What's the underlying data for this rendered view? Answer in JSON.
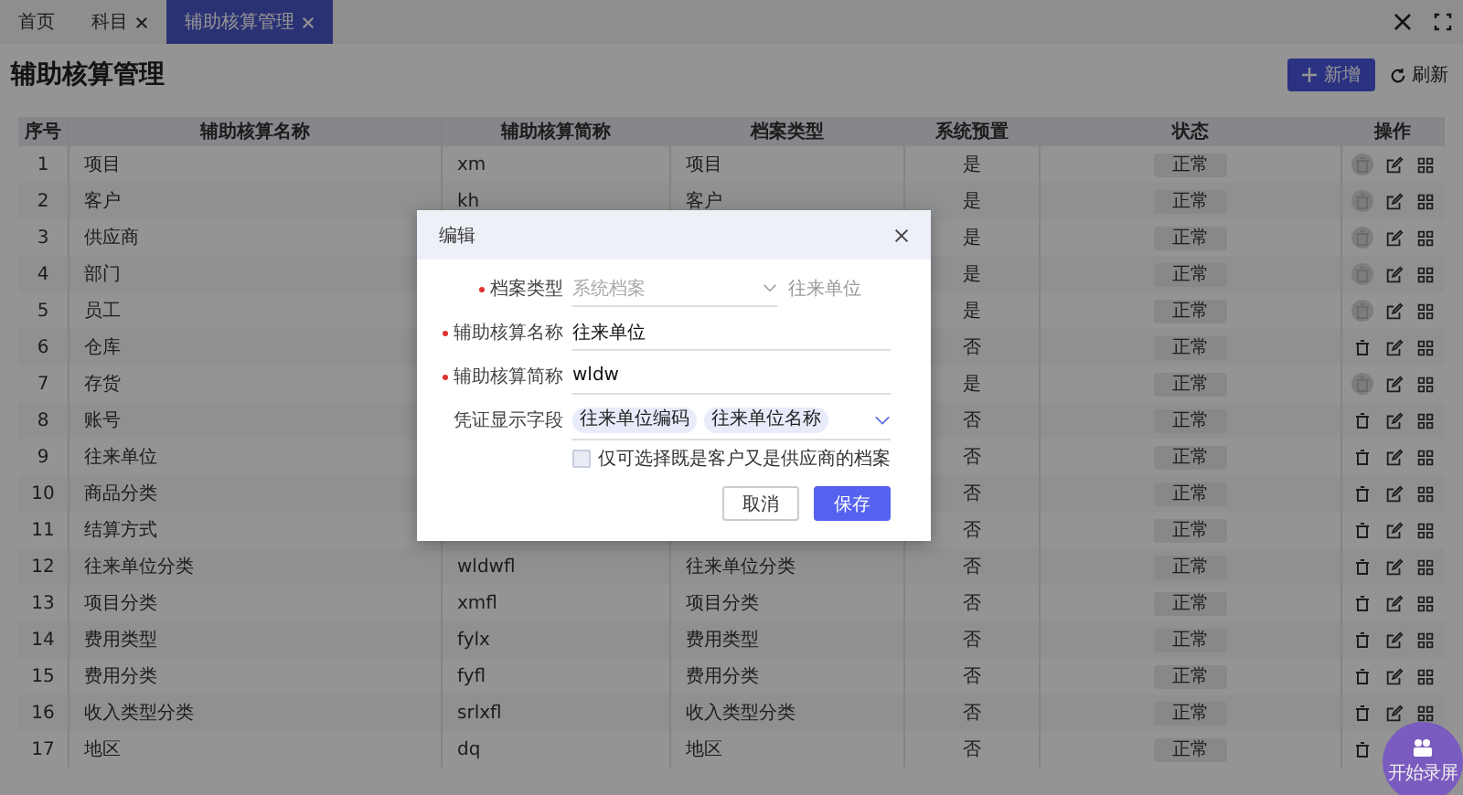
{
  "tabs": [
    {
      "label": "首页",
      "closable": false,
      "selected": false
    },
    {
      "label": "科目",
      "closable": true,
      "selected": false
    },
    {
      "label": "辅助核算管理",
      "closable": true,
      "selected": true
    }
  ],
  "page": {
    "title": "辅助核算管理",
    "add_button": "新增",
    "refresh_button": "刷新"
  },
  "table": {
    "columns": [
      "序号",
      "辅助核算名称",
      "辅助核算简称",
      "档案类型",
      "系统预置",
      "状态",
      "操作"
    ],
    "rows": [
      {
        "no": "1",
        "name": "项目",
        "code": "xm",
        "type": "项目",
        "preset": "是",
        "status": "正常",
        "delete_disabled": true
      },
      {
        "no": "2",
        "name": "客户",
        "code": "kh",
        "type": "客户",
        "preset": "是",
        "status": "正常",
        "delete_disabled": true
      },
      {
        "no": "3",
        "name": "供应商",
        "preset": "是",
        "status": "正常",
        "delete_disabled": true
      },
      {
        "no": "4",
        "name": "部门",
        "preset": "是",
        "status": "正常",
        "delete_disabled": true
      },
      {
        "no": "5",
        "name": "员工",
        "preset": "是",
        "status": "正常",
        "delete_disabled": true
      },
      {
        "no": "6",
        "name": "仓库",
        "preset": "否",
        "status": "正常",
        "delete_disabled": false
      },
      {
        "no": "7",
        "name": "存货",
        "preset": "是",
        "status": "正常",
        "delete_disabled": true
      },
      {
        "no": "8",
        "name": "账号",
        "preset": "否",
        "status": "正常",
        "delete_disabled": false
      },
      {
        "no": "9",
        "name": "往来单位",
        "preset": "否",
        "status": "正常",
        "delete_disabled": false
      },
      {
        "no": "10",
        "name": "商品分类",
        "preset": "否",
        "status": "正常",
        "delete_disabled": false
      },
      {
        "no": "11",
        "name": "结算方式",
        "preset": "否",
        "status": "正常",
        "delete_disabled": false
      },
      {
        "no": "12",
        "name": "往来单位分类",
        "code": "wldwfl",
        "type": "往来单位分类",
        "preset": "否",
        "status": "正常",
        "delete_disabled": false
      },
      {
        "no": "13",
        "name": "项目分类",
        "code": "xmfl",
        "type": "项目分类",
        "preset": "否",
        "status": "正常",
        "delete_disabled": false
      },
      {
        "no": "14",
        "name": "费用类型",
        "code": "fylx",
        "type": "费用类型",
        "preset": "否",
        "status": "正常",
        "delete_disabled": false
      },
      {
        "no": "15",
        "name": "费用分类",
        "code": "fyfl",
        "type": "费用分类",
        "preset": "否",
        "status": "正常",
        "delete_disabled": false
      },
      {
        "no": "16",
        "name": "收入类型分类",
        "code": "srlxfl",
        "type": "收入类型分类",
        "preset": "否",
        "status": "正常",
        "delete_disabled": false
      },
      {
        "no": "17",
        "name": "地区",
        "code": "dq",
        "type": "地区",
        "preset": "否",
        "status": "正常",
        "delete_disabled": false
      }
    ]
  },
  "dialog": {
    "title": "编辑",
    "fields": [
      {
        "kind": "select",
        "label": "档案类型",
        "required": true,
        "placeholder": "系统档案",
        "disabled": true,
        "extra": "往来单位"
      },
      {
        "kind": "text",
        "label": "辅助核算名称",
        "required": true,
        "value": "往来单位"
      },
      {
        "kind": "text",
        "label": "辅助核算简称",
        "required": true,
        "value": "wldw"
      },
      {
        "kind": "tags",
        "label": "凭证显示字段",
        "required": false,
        "tags": [
          "往来单位编码",
          "往来单位名称"
        ]
      }
    ],
    "checkbox": {
      "label": "仅可选择既是客户又是供应商的档案",
      "checked": false
    },
    "buttons": [
      {
        "label": "取消",
        "kind": "secondary"
      },
      {
        "label": "保存",
        "kind": "primary"
      }
    ]
  },
  "record_button": {
    "label": "开始录屏"
  }
}
